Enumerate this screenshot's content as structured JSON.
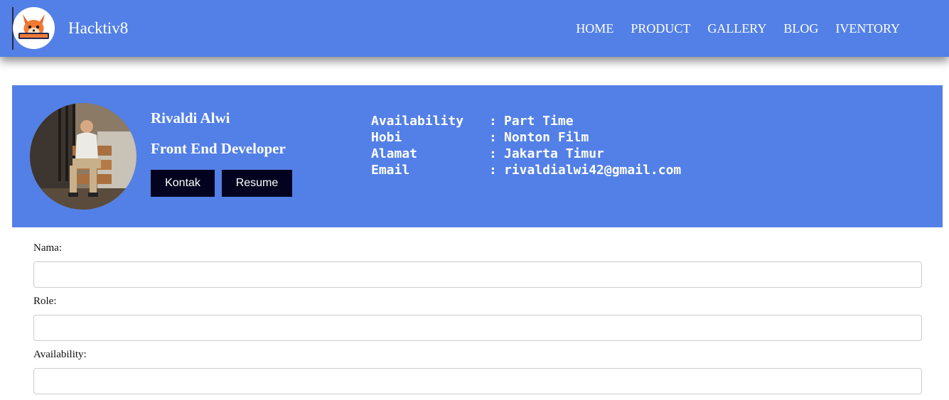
{
  "navbar": {
    "brand": "Hacktiv8",
    "logo_icon": "fox-mascot-logo-icon",
    "logo_text": "HACKTIV8",
    "links": [
      "HOME",
      "PRODUCT",
      "GALLERY",
      "BLOG",
      "IVENTORY"
    ],
    "color": "#5380e6"
  },
  "profile": {
    "name": "Rivaldi Alwi",
    "role": "Front End Developer",
    "buttons": {
      "kontak": "Kontak",
      "resume": "Resume"
    },
    "info": [
      {
        "key": "Availability",
        "value": "Part Time"
      },
      {
        "key": "Hobi",
        "value": "Nonton Film"
      },
      {
        "key": "Alamat",
        "value": "Jakarta Timur"
      },
      {
        "key": "Email",
        "value": "rivaldialwi42@gmail.com"
      }
    ],
    "colors": {
      "background": "#5380e6",
      "button": "#03031f"
    }
  },
  "form": {
    "fields": [
      {
        "label": "Nama:",
        "value": "",
        "placeholder": ""
      },
      {
        "label": "Role:",
        "value": "",
        "placeholder": ""
      },
      {
        "label": "Availability:",
        "value": "",
        "placeholder": ""
      }
    ]
  }
}
